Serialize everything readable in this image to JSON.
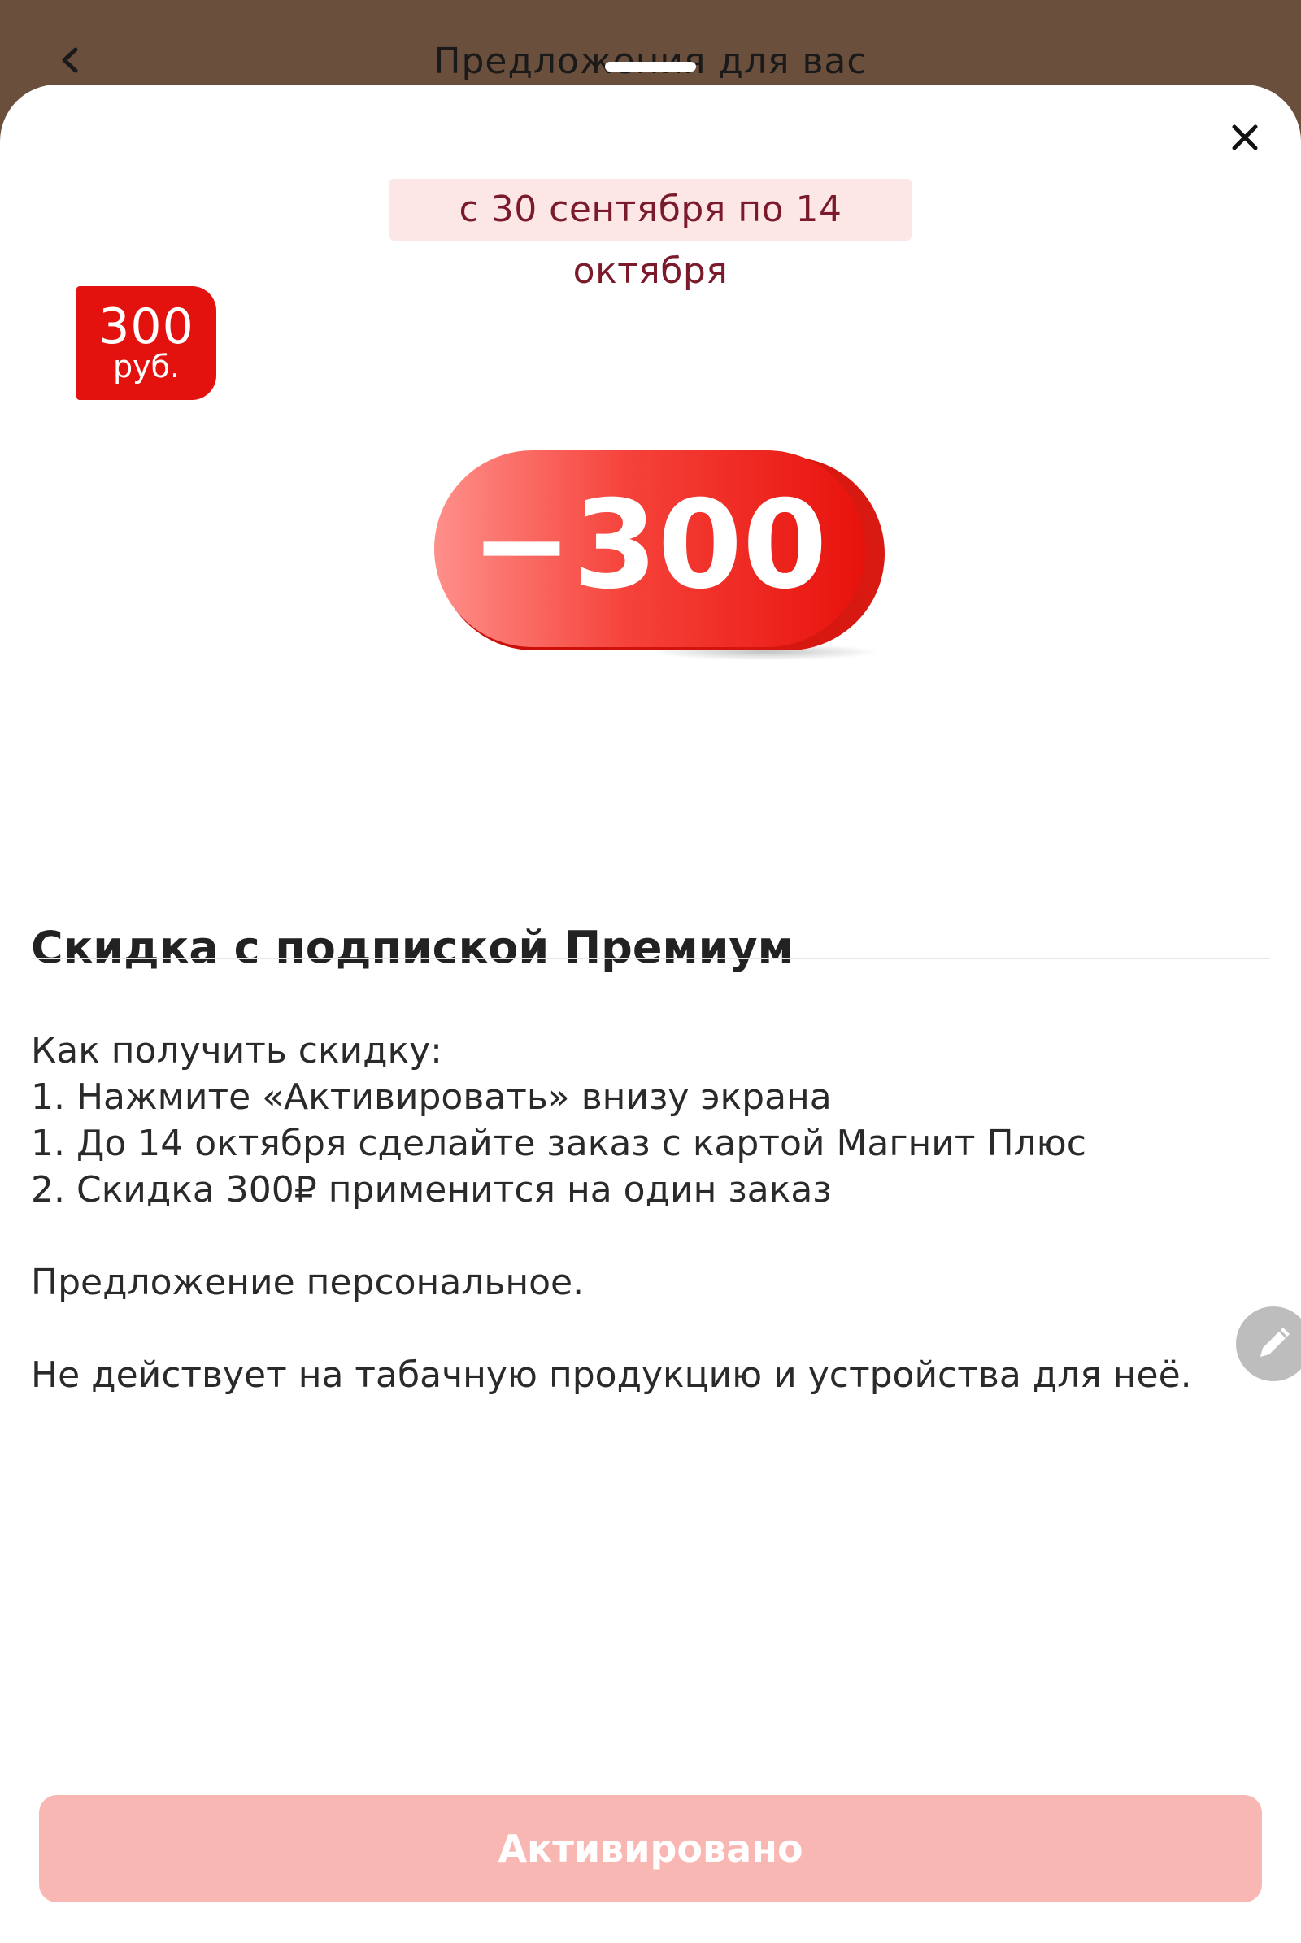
{
  "header": {
    "title": "Предложения для вас",
    "back_icon": "chevron-left-icon"
  },
  "sheet": {
    "close_icon": "close-icon",
    "date_range": "с 30 сентября по 14 октября",
    "badge": {
      "amount": "300",
      "unit": "руб."
    },
    "discount_art": {
      "label": "−300"
    },
    "title": "Скидка с подпиской Премиум",
    "description": [
      "Как получить скидку:",
      "1. Нажмите «Активировать» внизу экрана",
      "1. До 14 октября сделайте заказ с картой Магнит Плюс",
      "2. Скидка 300₽ применится на один заказ",
      "Предложение персональное.",
      "Не действует на табачную продукцию и устройства для неё."
    ],
    "action_button": {
      "label": "Активировано",
      "state": "disabled"
    },
    "edit_icon": "pencil-icon"
  },
  "colors": {
    "topbar": "#6a4f3d",
    "badge": "#e3120f",
    "date_chip_bg": "#fde6e6",
    "date_chip_text": "#7a1a2b",
    "button_disabled": "#f9b7b3"
  }
}
